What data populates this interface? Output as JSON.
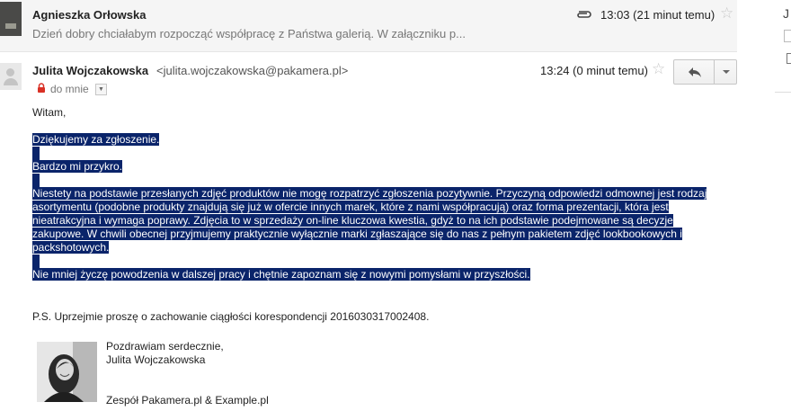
{
  "previous_message": {
    "sender": "Agnieszka Orłowska",
    "snippet": "Dzień dobry chciałabym rozpocząć współpracę z Państwa galerią. W załączniku p...",
    "time": "13:03 (21 minut temu)",
    "icons": [
      "paperclip-icon",
      "star-icon"
    ]
  },
  "sidebar": {
    "initial": "J"
  },
  "current_message": {
    "sender_name": "Julita Wojczakowska",
    "sender_email": "<julita.wojczakowska@pakamera.pl>",
    "to_label": "do mnie",
    "time": "13:24 (0 minut temu)",
    "icons": [
      "lock-icon",
      "star-icon",
      "reply-icon",
      "chevron-down-icon"
    ]
  },
  "body": {
    "greeting": "Witam,",
    "line1": "Dziękujemy  za zgłoszenie.",
    "line2": "Bardzo mi przykro.",
    "paragraph": "Niestety na podstawie przesłanych zdjęć produktów nie mogę rozpatrzyć zgłoszenia pozytywnie. Przyczyną odpowiedzi odmownej jest rodzaj asortymentu (podobne produkty znajdują się już w ofercie innych marek, które z nami współpracują) oraz forma prezentacji, która jest nieatrakcyjna i wymaga poprawy. Zdjęcia to w sprzedaży on-line kluczowa kwestia, gdyż to na ich podstawie  podejmowane są decyzje zakupowe. W chwili obecnej przyjmujemy praktycznie wyłącznie marki zgłaszające się do nas z pełnym pakietem zdjęć lookbookowych i packshotowych.",
    "line3": "Nie mniej życzę powodzenia w dalszej pracy i chętnie zapoznam się z nowymi pomysłami w przyszłości.",
    "ps": "P.S. Uprzejmie proszę o zachowanie ciągłości korespondencji 20160303170024​08."
  },
  "signature": {
    "greeting": "Pozdrawiam serdecznie,",
    "name": "Julita Wojczakowska",
    "team": "Zespół Pakamera.pl & Example.pl"
  },
  "colors": {
    "selection": "#0a246a",
    "header_bg": "#f5f5f5",
    "lock": "#d93025"
  }
}
